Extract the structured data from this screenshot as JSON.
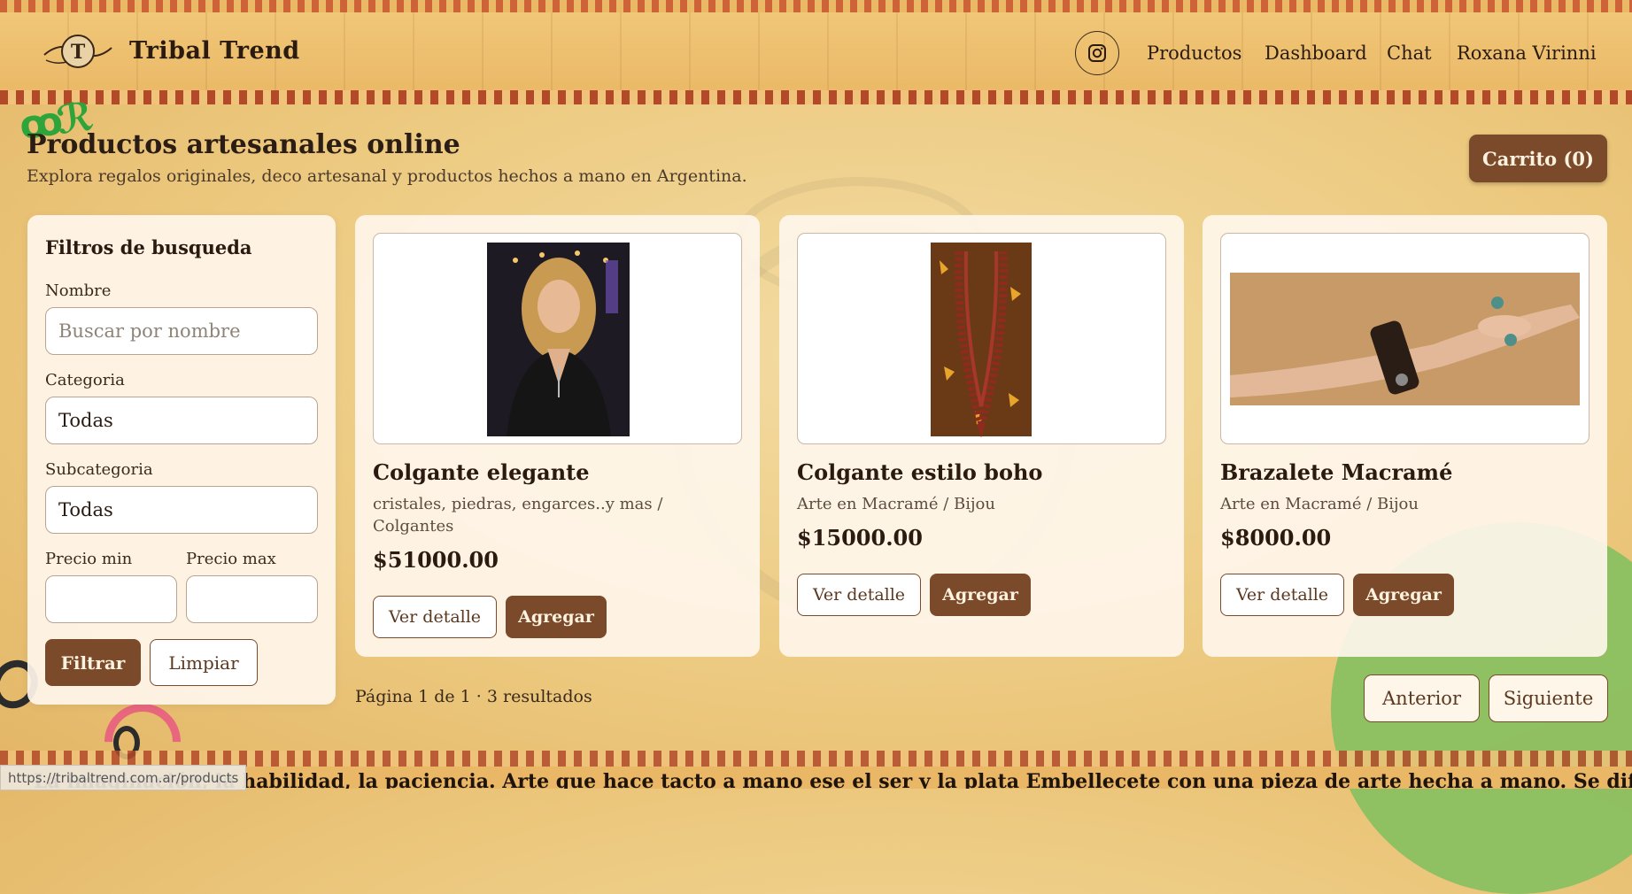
{
  "brand": "Tribal Trend",
  "nav": {
    "instagram_icon": "instagram-icon",
    "items": [
      "Productos",
      "Dashboard",
      "Chat",
      "Roxana Virinni"
    ]
  },
  "page": {
    "title": "Productos artesanales online",
    "subtitle": "Explora regalos originales, deco artesanal y productos hechos a mano en Argentina."
  },
  "cart": {
    "label": "Carrito (0)"
  },
  "filters": {
    "title": "Filtros de busqueda",
    "name_label": "Nombre",
    "name_placeholder": "Buscar por nombre",
    "category_label": "Categoria",
    "category_value": "Todas",
    "subcategory_label": "Subcategoria",
    "subcategory_value": "Todas",
    "price_min_label": "Precio min",
    "price_max_label": "Precio max",
    "price_min_value": "",
    "price_max_value": "",
    "filter_button": "Filtrar",
    "clear_button": "Limpiar"
  },
  "products": [
    {
      "name": "Colgante elegante",
      "category": "cristales, piedras, engarces..y mas / Colgantes",
      "price": "$51000.00",
      "detail_label": "Ver detalle",
      "add_label": "Agregar"
    },
    {
      "name": "Colgante estilo boho",
      "category": "Arte en Macramé / Bijou",
      "price": "$15000.00",
      "detail_label": "Ver detalle",
      "add_label": "Agregar"
    },
    {
      "name": "Brazalete Macramé",
      "category": "Arte en Macramé / Bijou",
      "price": "$8000.00",
      "detail_label": "Ver detalle",
      "add_label": "Agregar"
    }
  ],
  "pagination": {
    "info": "Página 1 de 1 · 3 resultados",
    "prev": "Anterior",
    "next": "Siguiente"
  },
  "footer": {
    "text": "La imaginación, la habilidad, la paciencia. Arte que hace tacto a mano ese el ser y la plata Embellecete con una pieza de arte hecha a mano. Se diferente"
  },
  "status_bar": {
    "url": "https://tribaltrend.com.ar/products"
  },
  "colors": {
    "accent": "#7a4a2b",
    "background": "#ecc97f",
    "card": "#fff6ec"
  }
}
